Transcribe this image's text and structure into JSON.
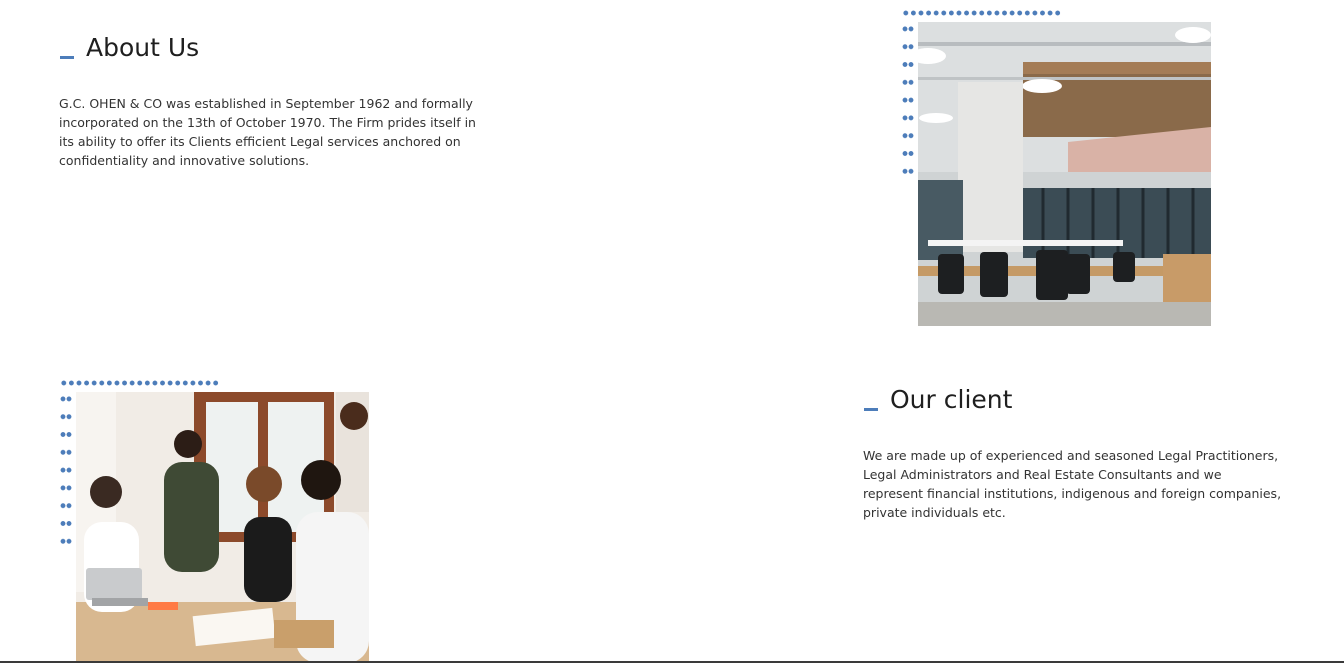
{
  "about": {
    "title": "About Us",
    "text": "G.C. OHEN & CO was established in September 1962 and formally incorporated on the 13th of October 1970. The Firm prides itself in its ability to offer its Clients efficient Legal services anchored on confidentiality and innovative solutions."
  },
  "client": {
    "title": "Our client",
    "text": "We are made up of experienced and seasoned Legal Practitioners, Legal Administrators and Real Estate Consultants and we represent financial institutions, indigenous and foreign companies, private individuals etc."
  },
  "colors": {
    "accent": "#4d7dba",
    "heading": "#1f1f1f",
    "body_text": "#333333"
  },
  "images": {
    "office": "office-interior-photo",
    "team": "team-meeting-photo"
  }
}
